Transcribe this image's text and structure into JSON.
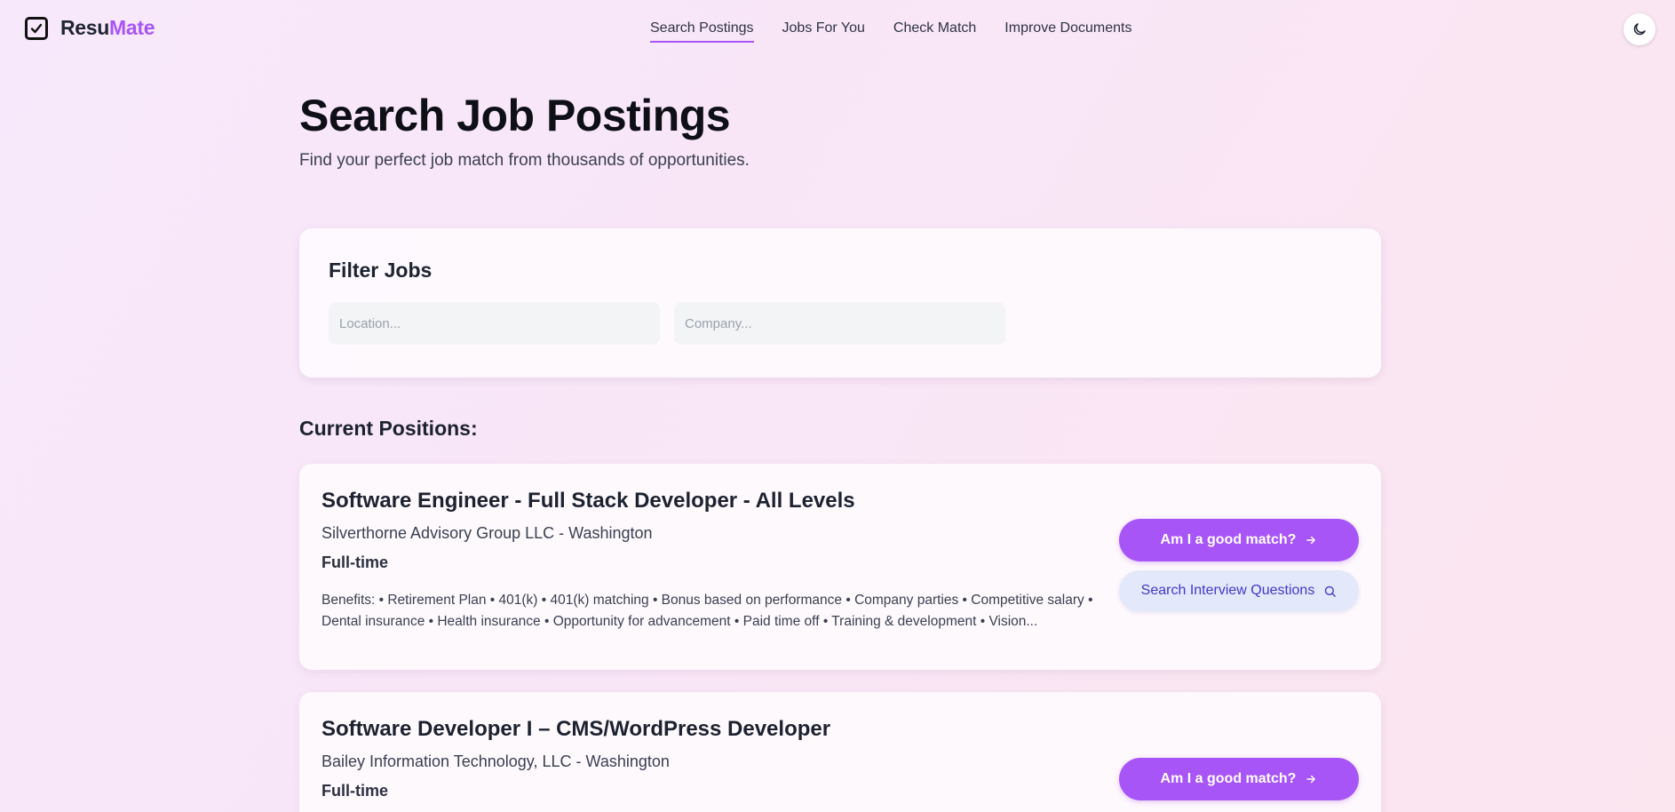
{
  "app": {
    "brand_prefix": "Resu",
    "brand_accent": "Mate",
    "accent_color": "#a855f7"
  },
  "nav": {
    "items": [
      {
        "label": "Search Postings",
        "active": true
      },
      {
        "label": "Jobs For You",
        "active": false
      },
      {
        "label": "Check Match",
        "active": false
      },
      {
        "label": "Improve Documents",
        "active": false
      }
    ],
    "theme_toggle_icon": "moon-icon"
  },
  "page": {
    "title": "Search Job Postings",
    "subtitle": "Find your perfect job match from thousands of opportunities."
  },
  "filter": {
    "title": "Filter Jobs",
    "location_placeholder": "Location...",
    "company_placeholder": "Company..."
  },
  "positions": {
    "heading": "Current Positions:",
    "jobs": [
      {
        "title": "Software Engineer - Full Stack Developer - All Levels",
        "company_location": "Silverthorne Advisory Group LLC - Washington",
        "type": "Full-time",
        "description": "Benefits: • Retirement Plan • 401(k) • 401(k) matching • Bonus based on performance • Company parties • Competitive salary • Dental insurance • Health insurance • Opportunity for advancement • Paid time off • Training & development • Vision...",
        "match_label": "Am I a good match?",
        "questions_label": "Search Interview Questions"
      },
      {
        "title": "Software Developer I – CMS/WordPress Developer",
        "company_location": "Bailey Information Technology, LLC - Washington",
        "type": "Full-time",
        "match_label": "Am I a good match?"
      }
    ]
  }
}
